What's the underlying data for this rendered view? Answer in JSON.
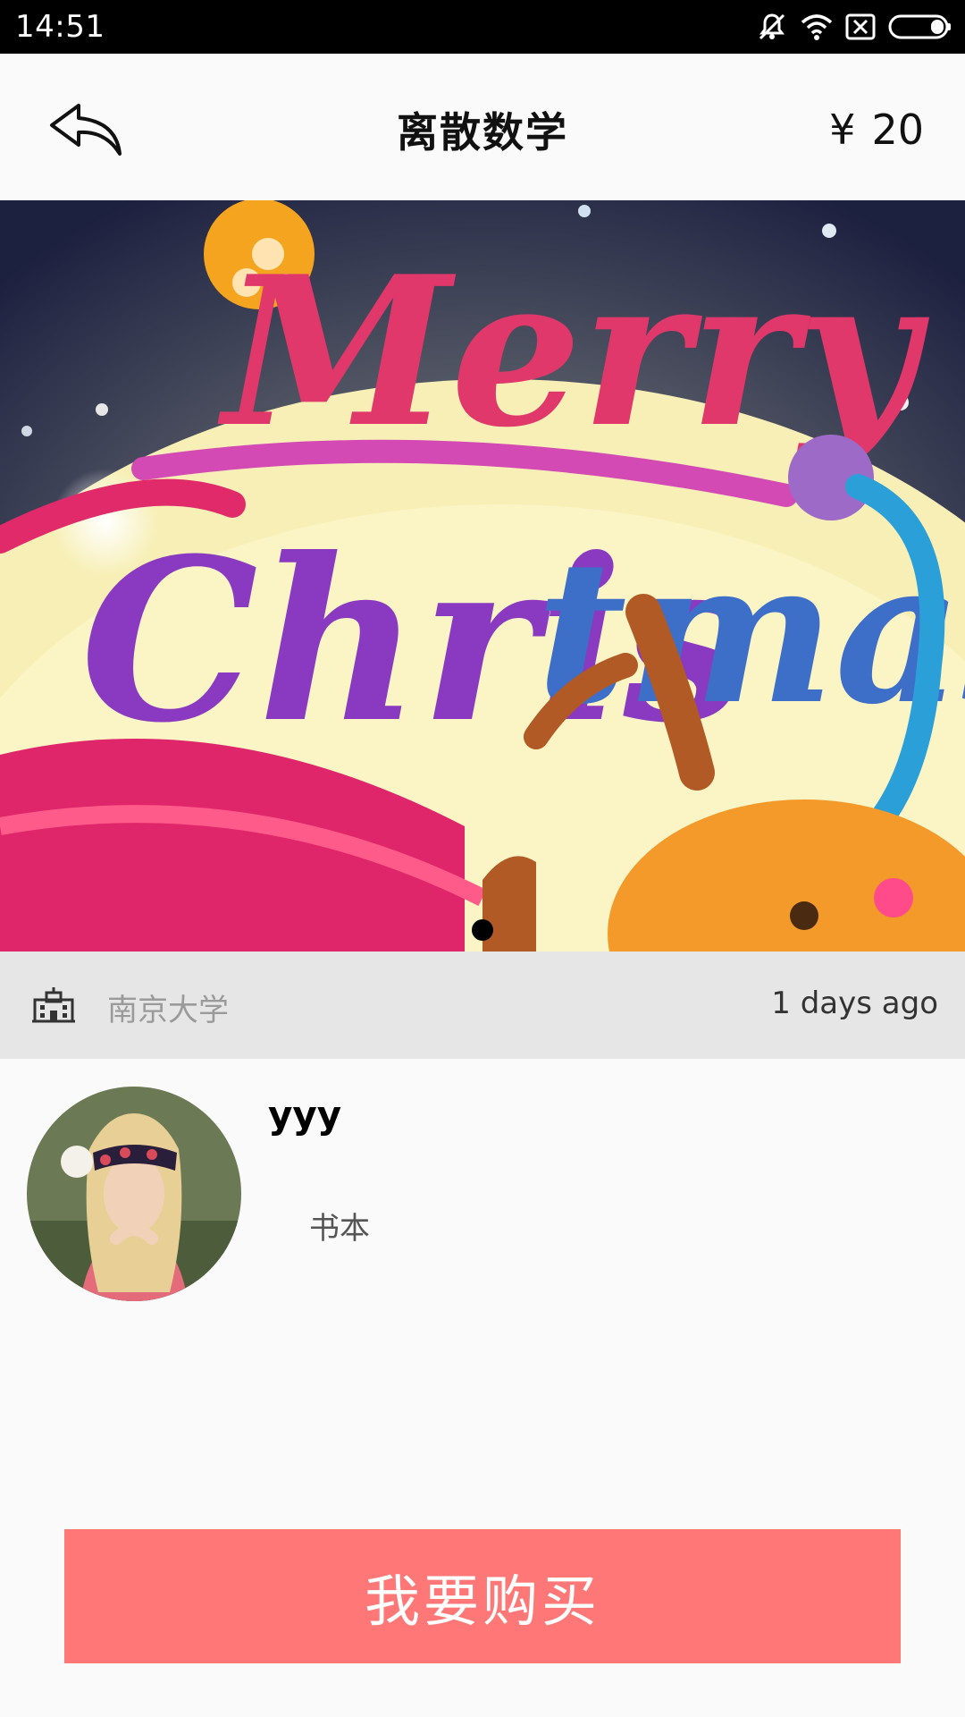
{
  "status_bar": {
    "time": "14:51",
    "icons": [
      "muted-notification-icon",
      "wifi-icon",
      "no-sim-icon",
      "battery-icon"
    ]
  },
  "header": {
    "title": "离散数学",
    "currency_symbol": "¥",
    "price": "20",
    "back_icon": "back-arrow-icon"
  },
  "banner": {
    "image_description_icon": "christmas-banner-image",
    "page_indicator": {
      "count": 1,
      "active": 1
    }
  },
  "info_bar": {
    "school_icon": "school-building-icon",
    "school": "南京大学",
    "posted": "1 days ago"
  },
  "seller": {
    "name": "yyy",
    "category": "书本"
  },
  "actions": {
    "buy_label": "我要购买"
  },
  "colors": {
    "status_bar_bg": "#000000",
    "page_bg": "#fafafa",
    "info_bar_bg": "#e6e6e6",
    "buy_button_bg": "#ff7777",
    "buy_button_text": "#ffffff"
  }
}
